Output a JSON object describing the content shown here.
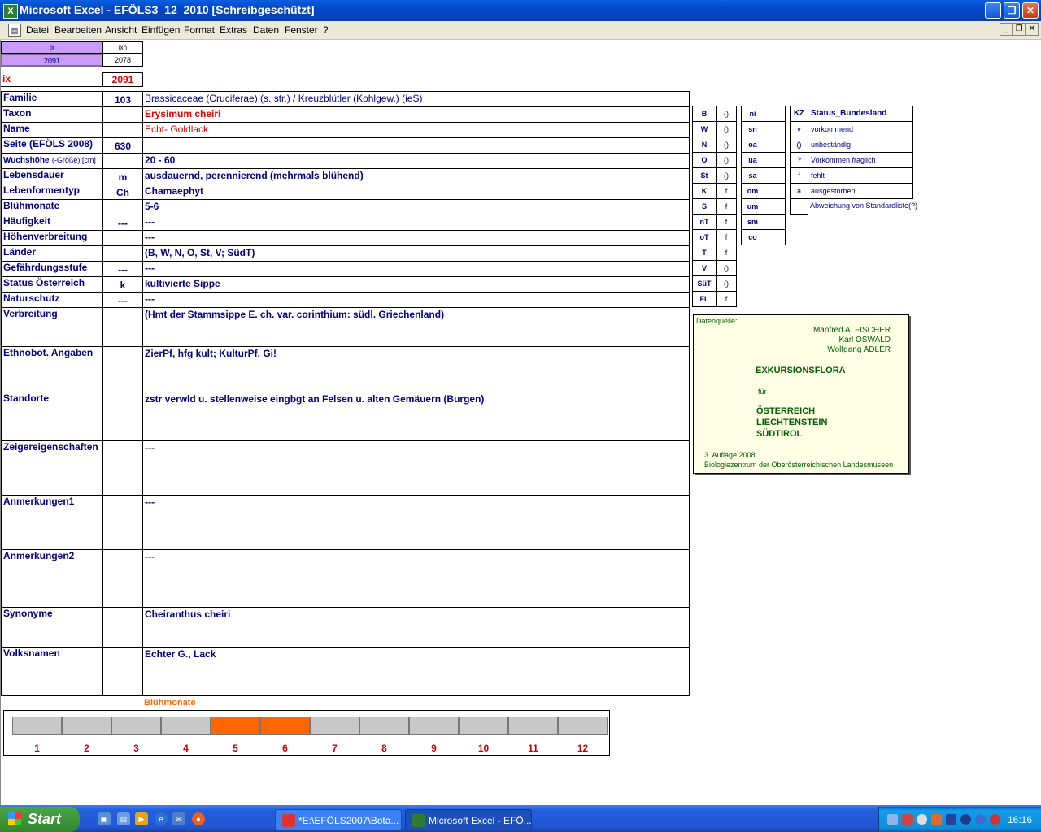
{
  "window": {
    "title": "Microsoft Excel - EFÖLS3_12_2010  [Schreibgeschützt]"
  },
  "menu": [
    "Datei",
    "Bearbeiten",
    "Ansicht",
    "Einfügen",
    "Format",
    "Extras",
    "Daten",
    "Fenster",
    "?"
  ],
  "header": {
    "ix_label": "ix",
    "ixn_label": "ixn",
    "ix_value": "2091",
    "ixn_value": "2078",
    "ix2_label": "ix",
    "ix2_value": "2091"
  },
  "fields": [
    {
      "label": "Familie",
      "code": "103",
      "value": "Brassicaceae (Cruciferae) (s. str.)  /  Kreuzblütler (Kohlgew.) (ieS)"
    },
    {
      "label": "Taxon",
      "code": "",
      "value": "Erysimum cheiri"
    },
    {
      "label": "Name",
      "code": "",
      "value": "Echt- Goldlack"
    },
    {
      "label": "Seite (EFÖLS 2008)",
      "code": "630",
      "value": ""
    },
    {
      "label": "Wuchshöhe",
      "label_suffix": "(-Größe) [cm]",
      "code": "",
      "value": " 20 - 60"
    },
    {
      "label": "Lebensdauer",
      "code": "m",
      "value": "ausdauernd, perennierend (mehrmals blühend)"
    },
    {
      "label": "Lebenformentyp",
      "code": "Ch",
      "value": "Chamaephyt"
    },
    {
      "label": "Blühmonate",
      "code": "",
      "value": " 5-6"
    },
    {
      "label": "Häufigkeit",
      "code": "---",
      "value": " ---"
    },
    {
      "label": "Höhenverbreitung",
      "code": "",
      "value": " ---"
    },
    {
      "label": "Länder",
      "code": "",
      "value": "(B, W, N, O, St, V; SüdT)"
    },
    {
      "label": "Gefährdungsstufe",
      "code": "---",
      "value": "   ---"
    },
    {
      "label": "Status Österreich",
      "code": "k",
      "value": "kultivierte Sippe"
    },
    {
      "label": "Naturschutz",
      "code": "---",
      "value": " ---"
    },
    {
      "label": "Verbreitung",
      "code": "",
      "value": "(Hmt der Stammsippe E. ch. var. corinthium: südl. Griechenland)"
    },
    {
      "label": "Ethnobot. Angaben",
      "code": "",
      "value": "ZierPf, hfg kult;  KulturPf.   Gi!"
    },
    {
      "label": "Standorte",
      "code": "",
      "value": "zstr verwld u. stellenweise eingbgt an Felsen u. alten Gemäuern (Burgen)"
    },
    {
      "label": "Zeigereigenschaften",
      "code": "",
      "value": "---"
    },
    {
      "label": "Anmerkungen1",
      "code": "",
      "value": "---"
    },
    {
      "label": "Anmerkungen2",
      "code": "",
      "value": "---"
    },
    {
      "label": "Synonyme",
      "code": "",
      "value": "Cheiranthus cheiri"
    },
    {
      "label": "Volksnamen",
      "code": "",
      "value": "Echter G., Lack"
    }
  ],
  "laender": [
    {
      "k": "B",
      "v": "()"
    },
    {
      "k": "W",
      "v": "()"
    },
    {
      "k": "N",
      "v": "()"
    },
    {
      "k": "O",
      "v": "()"
    },
    {
      "k": "St",
      "v": "()"
    },
    {
      "k": "K",
      "v": "f"
    },
    {
      "k": "S",
      "v": "f"
    },
    {
      "k": "nT",
      "v": "f"
    },
    {
      "k": "oT",
      "v": "f"
    },
    {
      "k": "T",
      "v": "f"
    },
    {
      "k": "V",
      "v": "()"
    },
    {
      "k": "SüT",
      "v": "()"
    },
    {
      "k": "FL",
      "v": "f"
    }
  ],
  "hoehen": [
    "ni",
    "sn",
    "oa",
    "ua",
    "sa",
    "om",
    "um",
    "sm",
    "co"
  ],
  "legend": {
    "header_k": "KZ",
    "header_v": "Status_Bundesland",
    "rows": [
      {
        "k": "v",
        "v": "vorkommend"
      },
      {
        "k": "()",
        "v": "unbeständig"
      },
      {
        "k": "?",
        "v": "Vorkommen fraglich"
      },
      {
        "k": "f",
        "v": "fehlt"
      },
      {
        "k": "a",
        "v": "ausgestorben"
      },
      {
        "k": "!",
        "v": "Abweichung von Standardliste(?)"
      }
    ]
  },
  "source": {
    "heading": "Datenquelle:",
    "authors": [
      "Manfred A. FISCHER",
      "Karl OSWALD",
      "Wolfgang ADLER"
    ],
    "book": "EXKURSIONSFLORA",
    "fuer": "für",
    "countries": [
      "ÖSTERREICH",
      "LIECHTENSTEIN",
      "SÜDTIROL"
    ],
    "edition": "3. Auflage 2008",
    "publisher": "Biologiezentrum der Oberösterreichischen Landesmuseen"
  },
  "bloom": {
    "title": "Blühmonate",
    "months": [
      "1",
      "2",
      "3",
      "4",
      "5",
      "6",
      "7",
      "8",
      "9",
      "10",
      "11",
      "12"
    ],
    "active": [
      5,
      6
    ]
  },
  "taskbar": {
    "start": "Start",
    "tasks": [
      "*E:\\EFÖLS2007\\Bota...",
      "Microsoft Excel - EFÖ..."
    ],
    "clock": "16:16"
  },
  "colors": {
    "accent_bar": "#ff6600",
    "inactive_bar": "#c8c8c8",
    "header_purple": "#cc99ff",
    "text_navy": "#000080",
    "text_red": "#e00000"
  }
}
